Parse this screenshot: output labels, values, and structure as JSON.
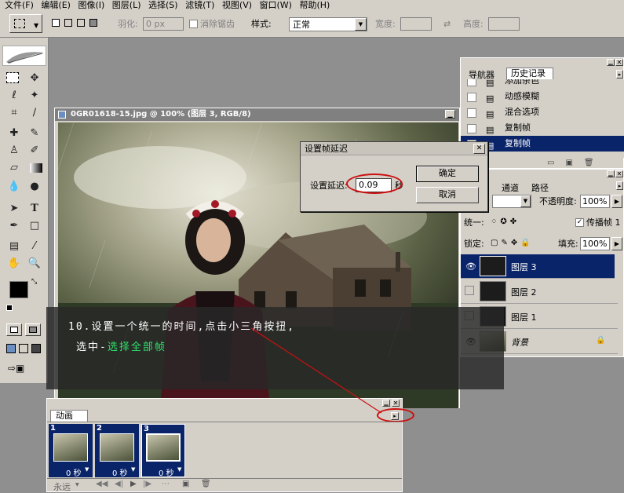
{
  "menu": [
    "文件(F)",
    "编辑(E)",
    "图像(I)",
    "图层(L)",
    "选择(S)",
    "滤镜(T)",
    "视图(V)",
    "窗口(W)",
    "帮助(H)"
  ],
  "options": {
    "feather_label": "羽化:",
    "feather_value": "0 px",
    "antialias_label": "消除锯齿",
    "style_label": "样式:",
    "style_value": "正常",
    "width_label": "宽度:",
    "height_label": "高度:"
  },
  "document": {
    "title": "0GR01618-15.jpg @ 100% (图层 3, RGB/8)"
  },
  "dialog": {
    "title": "设置帧延迟",
    "field_label": "设置延迟:",
    "value": "0.09",
    "unit": "秒",
    "ok": "确定",
    "cancel": "取消"
  },
  "caption": {
    "line1": "10.设置一个统一的时间,点击小三角按扭,",
    "line2_prefix": "选中-",
    "line2_highlight": "选择全部帧"
  },
  "animation": {
    "tab": "动画",
    "frames": [
      {
        "num": "1",
        "delay": "0 秒"
      },
      {
        "num": "2",
        "delay": "0 秒"
      },
      {
        "num": "3",
        "delay": "0 秒"
      }
    ],
    "loop": "永远"
  },
  "history": {
    "tabs": [
      "导航器",
      "历史记录"
    ],
    "items": [
      "添加杂色",
      "动感模糊",
      "混合选项",
      "复制帧",
      "复制帧"
    ],
    "selected_index": 4
  },
  "layers": {
    "tabs": [
      "通道",
      "路径"
    ],
    "opacity_label": "不透明度:",
    "opacity_value": "100%",
    "unify_label": "统一:",
    "propagate_label": "传播帧 1",
    "lock_label": "锁定:",
    "fill_label": "填充:",
    "fill_value": "100%",
    "items": [
      {
        "name": "图层 3",
        "selected": true,
        "visible": true
      },
      {
        "name": "图层 2",
        "selected": false,
        "visible": false
      },
      {
        "name": "图层 1",
        "selected": false,
        "visible": false
      },
      {
        "name": "背景",
        "selected": false,
        "visible": true,
        "locked": true
      }
    ]
  },
  "colors": {
    "selection": "#0a246a",
    "caption_highlight": "#2fe06a",
    "annotation": "#cc1111"
  }
}
